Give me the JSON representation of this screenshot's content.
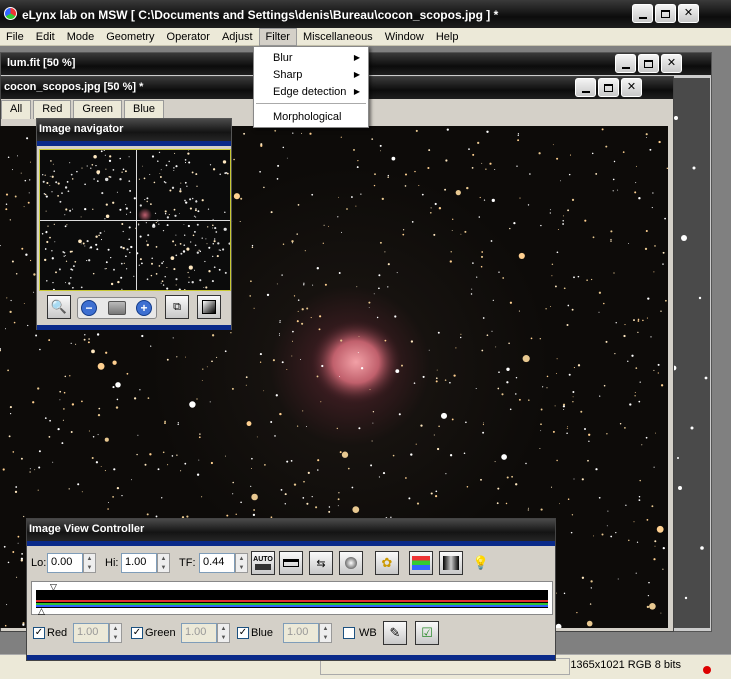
{
  "window": {
    "title": "eLynx lab on MSW   [ C:\\Documents and Settings\\denis\\Bureau\\cocon_scopos.jpg ] *",
    "minimize": "",
    "maximize": "",
    "close": "✕"
  },
  "menubar": {
    "items": [
      "File",
      "Edit",
      "Mode",
      "Geometry",
      "Operator",
      "Adjust",
      "Filter",
      "Miscellaneous",
      "Window",
      "Help"
    ]
  },
  "filter_menu": {
    "items": [
      {
        "label": "Blur",
        "submenu": true
      },
      {
        "label": "Sharp",
        "submenu": true
      },
      {
        "label": "Edge detection",
        "submenu": true
      },
      {
        "label": "Morphological",
        "submenu": false
      }
    ]
  },
  "lum_window": {
    "title": "lum.fit [50 %]"
  },
  "cocon_window": {
    "title": "cocon_scopos.jpg [50 %] *",
    "tabs": [
      "All",
      "Red",
      "Green",
      "Blue"
    ]
  },
  "navigator": {
    "title": "Image navigator"
  },
  "controller": {
    "title": "Image View Controller",
    "lo_label": "Lo:",
    "lo_value": "0.00",
    "hi_label": "Hi:",
    "hi_value": "1.00",
    "tf_label": "TF:",
    "tf_value": "0.44",
    "auto_label": "AUTO",
    "channels": [
      {
        "label": "Red",
        "checked": true,
        "value": "1.00"
      },
      {
        "label": "Green",
        "checked": true,
        "value": "1.00"
      },
      {
        "label": "Blue",
        "checked": true,
        "value": "1.00"
      }
    ],
    "wb_label": "WB"
  },
  "status": {
    "dims": "1365x1021 RGB 8 bits"
  },
  "colors": {
    "titlebar": "#0c0c0c",
    "sky": "#0d0b09",
    "nebula": "#c06070",
    "nav_blue": "#0a2a8a"
  }
}
